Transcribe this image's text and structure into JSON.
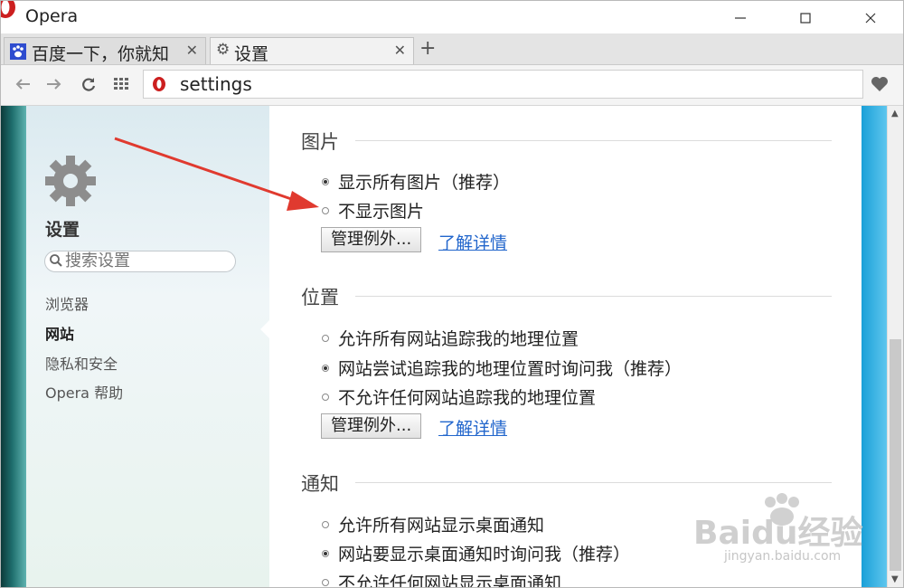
{
  "window": {
    "title": "Opera",
    "brand_color": "#cc1f1f",
    "controls": [
      "minimize",
      "maximize",
      "close"
    ]
  },
  "tabs": [
    {
      "title": "百度一下，你就知",
      "icon": "paw-icon",
      "active": false
    },
    {
      "title": "设置",
      "icon": "gear-icon",
      "active": true
    }
  ],
  "new_tab_label": "+",
  "address_bar": {
    "url": "settings"
  },
  "sidebar": {
    "title": "设置",
    "search_placeholder": "搜索设置",
    "items": [
      {
        "label": "浏览器",
        "active": false
      },
      {
        "label": "网站",
        "active": true
      },
      {
        "label": "隐私和安全",
        "active": false
      },
      {
        "label": "Opera 帮助",
        "active": false
      }
    ]
  },
  "sections": {
    "images": {
      "title": "图片",
      "options": [
        {
          "label": "显示所有图片（推荐）",
          "checked": true
        },
        {
          "label": "不显示图片",
          "checked": false
        }
      ],
      "button": "管理例外...",
      "link": "了解详情"
    },
    "location": {
      "title": "位置",
      "options": [
        {
          "label": "允许所有网站追踪我的地理位置",
          "checked": false
        },
        {
          "label": "网站尝试追踪我的地理位置时询问我（推荐）",
          "checked": true
        },
        {
          "label": "不允许任何网站追踪我的地理位置",
          "checked": false
        }
      ],
      "button": "管理例外...",
      "link": "了解详情"
    },
    "notifications": {
      "title": "通知",
      "options": [
        {
          "label": "允许所有网站显示桌面通知",
          "checked": false
        },
        {
          "label": "网站要显示桌面通知时询问我（推荐）",
          "checked": true
        },
        {
          "label": "不允许任何网站显示桌面通知",
          "checked": false
        }
      ]
    }
  },
  "watermark": {
    "text": "Baidu经验",
    "sub": "jingyan.baidu.com"
  },
  "annotation_color": "#e03a2f"
}
